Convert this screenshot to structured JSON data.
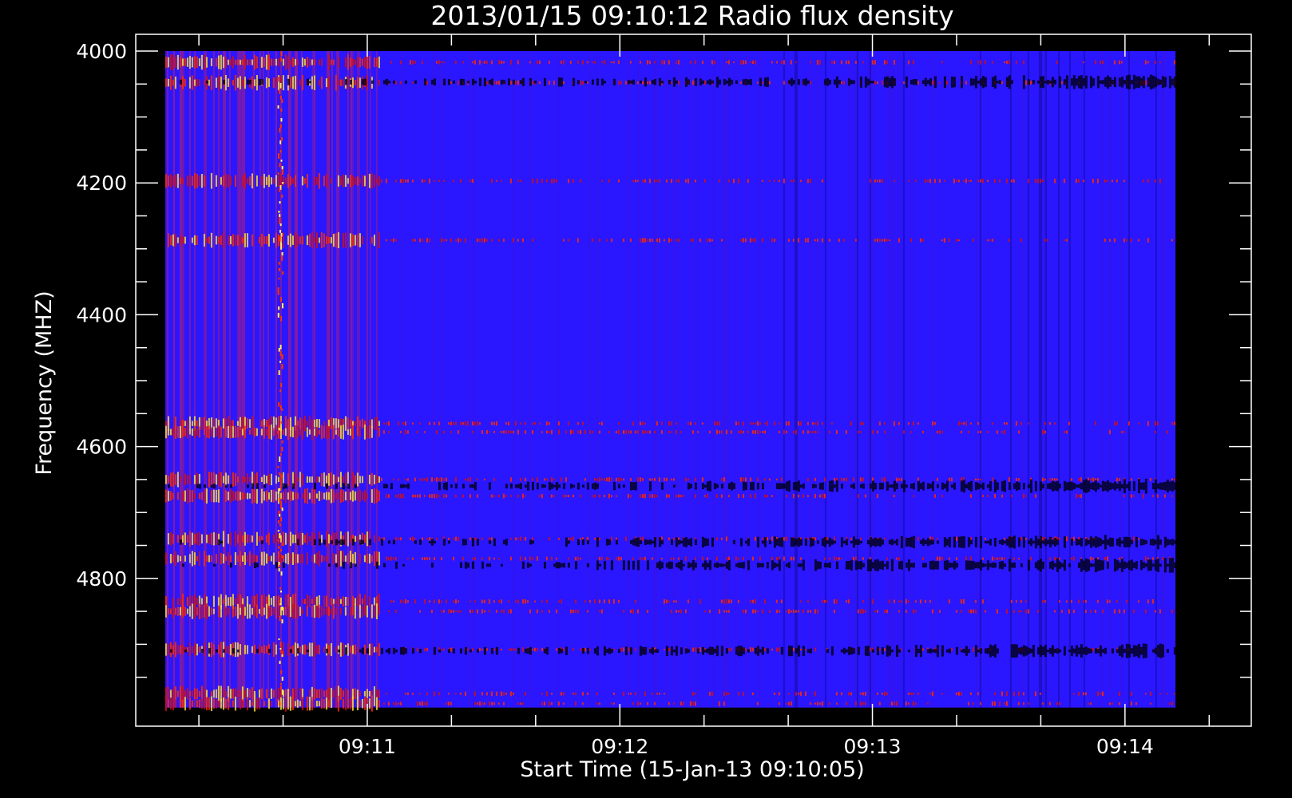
{
  "chart_data": {
    "type": "heatmap",
    "title": "2013/01/15 09:10:12 Radio flux density",
    "xlabel": "Start Time (15-Jan-13 09:10:05)",
    "ylabel": "Frequency (MHZ)",
    "x_ticks": [
      "09:11",
      "09:12",
      "09:13",
      "09:14"
    ],
    "y_ticks": [
      "4000",
      "4200",
      "4400",
      "4600",
      "4800"
    ],
    "xlim": [
      "09:10:05",
      "09:14:30"
    ],
    "ylim": [
      4000,
      5000
    ],
    "data_x_range": [
      "09:10:12",
      "09:14:12"
    ],
    "data_y_range": [
      4000,
      4996
    ],
    "y_axis_inverted": true,
    "colormap": [
      "#000000",
      "#1a10ff",
      "#ff2000",
      "#ffff40"
    ],
    "background_color": "#2a16ff",
    "bright_bands_mhz": [
      4017,
      4048,
      4197,
      4287,
      4565,
      4578,
      4650,
      4675,
      4740,
      4770,
      4835,
      4850,
      4908,
      4975,
      4990
    ],
    "dark_bands_mhz": [
      4047,
      4660,
      4745,
      4780,
      4910
    ],
    "intense_period_end": "09:11:03",
    "burst_column_time": "09:10:39"
  }
}
